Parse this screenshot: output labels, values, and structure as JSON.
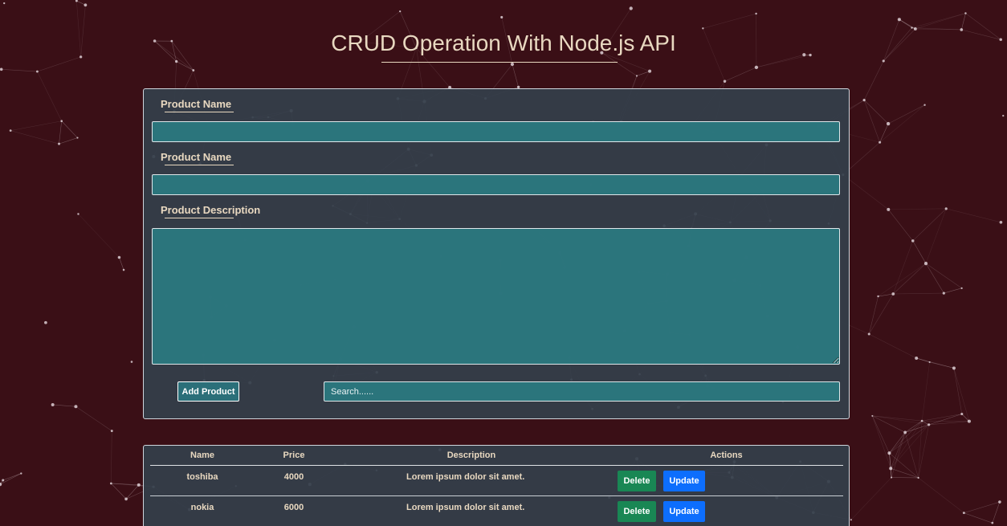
{
  "header": {
    "title": "CRUD Operation With Node.js API"
  },
  "form": {
    "field1_label": "Product Name",
    "field1_value": "",
    "field2_label": "Product Name",
    "field2_value": "",
    "description_label": "Product Description",
    "description_value": "",
    "add_button_label": "Add Product",
    "search_placeholder": "Search......"
  },
  "table": {
    "headers": [
      "Name",
      "Price",
      "Description",
      "Actions"
    ],
    "rows": [
      {
        "name": "toshiba",
        "price": "4000",
        "description": "Lorem ipsum dolor sit amet."
      },
      {
        "name": "nokia",
        "price": "6000",
        "description": "Lorem ipsum dolor sit amet."
      }
    ],
    "delete_label": "Delete",
    "update_label": "Update"
  },
  "colors": {
    "background": "#3a0f16",
    "card": "#343e4a",
    "input_fill": "#2b7880",
    "text_cream": "#e8d8c0",
    "delete_green": "#198754",
    "update_blue": "#0d6efd"
  }
}
